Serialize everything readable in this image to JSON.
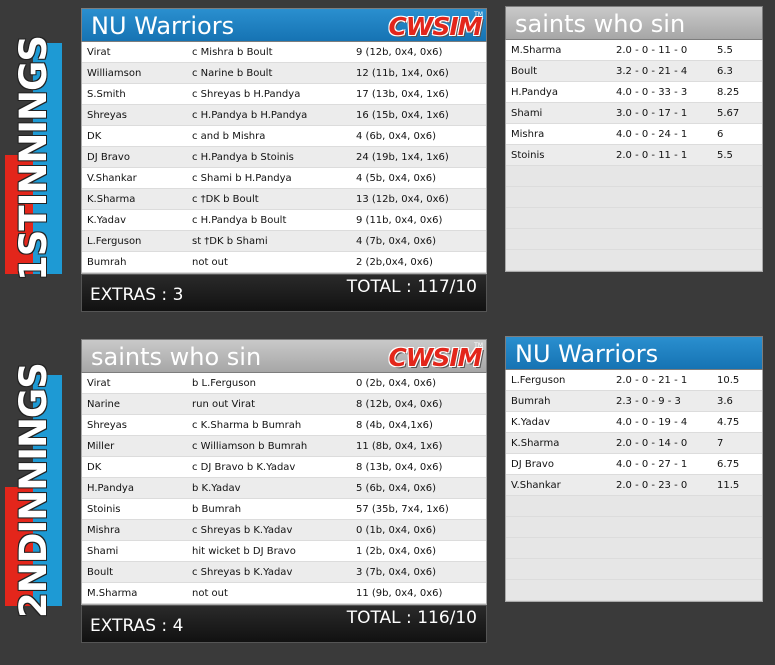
{
  "labels": {
    "extras": "EXTRAS : ",
    "total": "TOTAL : "
  },
  "logo": {
    "text": "CWSIM",
    "tm": "TM"
  },
  "innings1": {
    "tag_num": "1ST",
    "tag_word": "INNINGS",
    "batting": {
      "team": "NU Warriors",
      "rows": [
        [
          "Virat",
          "c Mishra b Boult",
          "9 (12b, 0x4, 0x6)"
        ],
        [
          "Williamson",
          "c Narine b Boult",
          "12 (11b, 1x4, 0x6)"
        ],
        [
          "S.Smith",
          "c Shreyas b H.Pandya",
          "17 (13b, 0x4, 1x6)"
        ],
        [
          "Shreyas",
          "c H.Pandya b H.Pandya",
          "16 (15b, 0x4, 1x6)"
        ],
        [
          "DK",
          "c and b Mishra",
          "4 (6b, 0x4, 0x6)"
        ],
        [
          "DJ Bravo",
          "c H.Pandya b Stoinis",
          "24 (19b, 1x4, 1x6)"
        ],
        [
          "V.Shankar",
          "c Shami b H.Pandya",
          "4 (5b, 0x4, 0x6)"
        ],
        [
          "K.Sharma",
          "c †DK b Boult",
          "13 (12b, 0x4, 0x6)"
        ],
        [
          "K.Yadav",
          "c H.Pandya b Boult",
          "9 (11b, 0x4, 0x6)"
        ],
        [
          "L.Ferguson",
          "st †DK b Shami",
          "4 (7b, 0x4, 0x6)"
        ],
        [
          "Bumrah",
          "not out",
          "2 (2b,0x4, 0x6)"
        ]
      ],
      "extras": "3",
      "total": "117/10"
    },
    "bowling": {
      "team": "saints who sin",
      "rows": [
        [
          "M.Sharma",
          "2.0 - 0 - 11 - 0",
          "5.5"
        ],
        [
          "Boult",
          "3.2 - 0 - 21 - 4",
          "6.3"
        ],
        [
          "H.Pandya",
          "4.0 - 0 - 33 - 3",
          "8.25"
        ],
        [
          "Shami",
          "3.0 - 0 - 17 - 1",
          "5.67"
        ],
        [
          "Mishra",
          "4.0 - 0 - 24 - 1",
          "6"
        ],
        [
          "Stoinis",
          "2.0 - 0 - 11 - 1",
          "5.5"
        ]
      ]
    }
  },
  "innings2": {
    "tag_num": "2ND",
    "tag_word": "INNINGS",
    "batting": {
      "team": "saints who sin",
      "rows": [
        [
          "Virat",
          "b L.Ferguson",
          "0 (2b, 0x4, 0x6)"
        ],
        [
          "Narine",
          "run out Virat",
          "8 (12b, 0x4, 0x6)"
        ],
        [
          "Shreyas",
          "c K.Sharma b Bumrah",
          "8 (4b, 0x4,1x6)"
        ],
        [
          "Miller",
          "c Williamson b Bumrah",
          "11 (8b, 0x4, 1x6)"
        ],
        [
          "DK",
          "c DJ Bravo b K.Yadav",
          "8 (13b, 0x4, 0x6)"
        ],
        [
          "H.Pandya",
          "b K.Yadav",
          "5 (6b, 0x4, 0x6)"
        ],
        [
          "Stoinis",
          "b Bumrah",
          "57 (35b, 7x4, 1x6)"
        ],
        [
          "Mishra",
          "c Shreyas b K.Yadav",
          "0 (1b, 0x4, 0x6)"
        ],
        [
          "Shami",
          "hit wicket b DJ Bravo",
          "1 (2b, 0x4, 0x6)"
        ],
        [
          "Boult",
          "c Shreyas b K.Yadav",
          "3 (7b, 0x4, 0x6)"
        ],
        [
          "M.Sharma",
          "not out",
          "11 (9b, 0x4, 0x6)"
        ]
      ],
      "extras": "4",
      "total": "116/10"
    },
    "bowling": {
      "team": "NU Warriors",
      "rows": [
        [
          "L.Ferguson",
          "2.0 - 0 - 21 - 1",
          "10.5"
        ],
        [
          "Bumrah",
          "2.3 - 0 - 9 - 3",
          "3.6"
        ],
        [
          "K.Yadav",
          "4.0 - 0 - 19 - 4",
          "4.75"
        ],
        [
          "K.Sharma",
          "2.0 - 0 - 14 - 0",
          "7"
        ],
        [
          "DJ Bravo",
          "4.0 - 0 - 27 - 1",
          "6.75"
        ],
        [
          "V.Shankar",
          "2.0 - 0 - 23 - 0",
          "11.5"
        ]
      ]
    }
  }
}
